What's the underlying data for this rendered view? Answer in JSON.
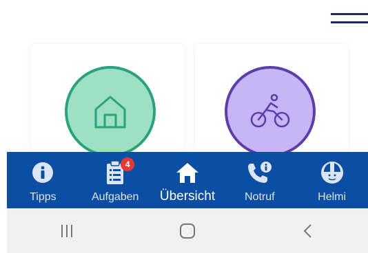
{
  "colors": {
    "nav_background": "#0b4ea2",
    "home_fill": "#9ee0c2",
    "home_ring": "#2aa27d",
    "bike_fill": "#c8b5f8",
    "bike_ring": "#5a3fa8",
    "badge": "#e53935"
  },
  "cards": [
    {
      "icon": "home-icon"
    },
    {
      "icon": "bicycle-icon"
    }
  ],
  "nav": {
    "items": [
      {
        "label": "Tipps",
        "icon": "info-icon"
      },
      {
        "label": "Aufgaben",
        "icon": "clipboard-icon",
        "badge": "4"
      },
      {
        "label": "Übersicht",
        "icon": "home-icon",
        "active": true
      },
      {
        "label": "Notruf",
        "icon": "phone-info-icon"
      },
      {
        "label": "Helmi",
        "icon": "helmet-icon"
      }
    ]
  },
  "system_nav": {
    "icons": [
      "recent-apps-icon",
      "home-button-icon",
      "back-icon"
    ]
  }
}
